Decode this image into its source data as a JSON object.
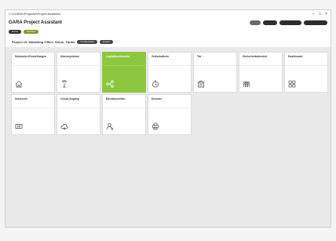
{
  "window": {
    "title": "C:\\\\GARA\\\\Projects\\\\Project Assistant",
    "controls": [
      "–",
      "□",
      "×"
    ]
  },
  "app": {
    "title": "GARA Project Assistant",
    "header_buttons": [
      "",
      "",
      "",
      ""
    ]
  },
  "tabs": [
    {
      "label": "Home"
    },
    {
      "label": "Modules"
    }
  ],
  "project": {
    "label": "Project 15, Marketing Office, Sirius, Türkis",
    "buttons": [
      "Configuration",
      "Export"
    ]
  },
  "tiles": [
    {
      "label": "Submeter-Einstellungen",
      "icon": "house-icon",
      "active": false
    },
    {
      "label": "Alarmsysteme",
      "icon": "antenna-icon",
      "active": false
    },
    {
      "label": "Logistiknetzwerke",
      "icon": "network-icon",
      "active": true
    },
    {
      "label": "Zeitschaltuhr",
      "icon": "clock-icon",
      "active": false
    },
    {
      "label": "Tür",
      "icon": "door-icon",
      "active": false
    },
    {
      "label": "Sicherheitsbereich",
      "icon": "people-icon",
      "active": false
    },
    {
      "label": "Dashboard",
      "icon": "grid-icon",
      "active": false
    },
    {
      "label": "Sensoren",
      "icon": "sensor-icon",
      "active": false
    },
    {
      "label": "Cloud-Zugang",
      "icon": "cloud-icon",
      "active": false
    },
    {
      "label": "Benutzerrollen",
      "icon": "user-icon",
      "active": false
    },
    {
      "label": "Drucker",
      "icon": "printer-icon",
      "active": false
    }
  ]
}
